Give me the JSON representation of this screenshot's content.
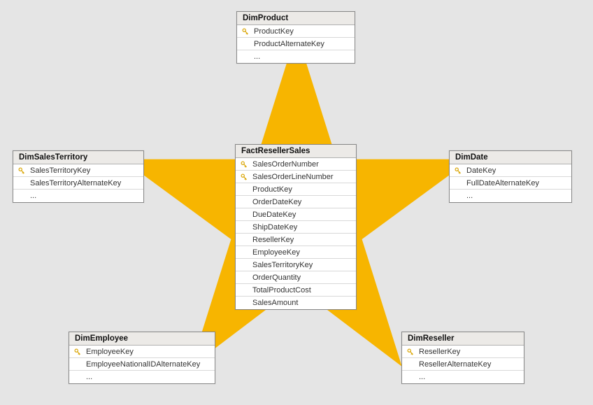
{
  "entities": {
    "dimProduct": {
      "title": "DimProduct",
      "rows": [
        {
          "name": "ProductKey",
          "key": true
        },
        {
          "name": "ProductAlternateKey",
          "key": false
        },
        {
          "name": "...",
          "key": false
        }
      ]
    },
    "dimSalesTerritory": {
      "title": "DimSalesTerritory",
      "rows": [
        {
          "name": "SalesTerritoryKey",
          "key": true
        },
        {
          "name": "SalesTerritoryAlternateKey",
          "key": false
        },
        {
          "name": "...",
          "key": false
        }
      ]
    },
    "factResellerSales": {
      "title": "FactResellerSales",
      "rows": [
        {
          "name": "SalesOrderNumber",
          "key": true
        },
        {
          "name": "SalesOrderLineNumber",
          "key": true
        },
        {
          "name": "ProductKey",
          "key": false
        },
        {
          "name": "OrderDateKey",
          "key": false
        },
        {
          "name": "DueDateKey",
          "key": false
        },
        {
          "name": "ShipDateKey",
          "key": false
        },
        {
          "name": "ResellerKey",
          "key": false
        },
        {
          "name": "EmployeeKey",
          "key": false
        },
        {
          "name": "SalesTerritoryKey",
          "key": false
        },
        {
          "name": "OrderQuantity",
          "key": false
        },
        {
          "name": "TotalProductCost",
          "key": false
        },
        {
          "name": "SalesAmount",
          "key": false
        }
      ]
    },
    "dimDate": {
      "title": "DimDate",
      "rows": [
        {
          "name": "DateKey",
          "key": true
        },
        {
          "name": "FullDateAlternateKey",
          "key": false
        },
        {
          "name": "...",
          "key": false
        }
      ]
    },
    "dimEmployee": {
      "title": "DimEmployee",
      "rows": [
        {
          "name": "EmployeeKey",
          "key": true
        },
        {
          "name": "EmployeeNationalIDAlternateKey",
          "key": false
        },
        {
          "name": "...",
          "key": false
        }
      ]
    },
    "dimReseller": {
      "title": "DimReseller",
      "rows": [
        {
          "name": "ResellerKey",
          "key": true
        },
        {
          "name": "ResellerAlternateKey",
          "key": false
        },
        {
          "name": "...",
          "key": false
        }
      ]
    }
  },
  "colors": {
    "star": "#f7b500",
    "background": "#e5e5e5",
    "entityHeader": "#eceae7",
    "border": "#888888"
  }
}
